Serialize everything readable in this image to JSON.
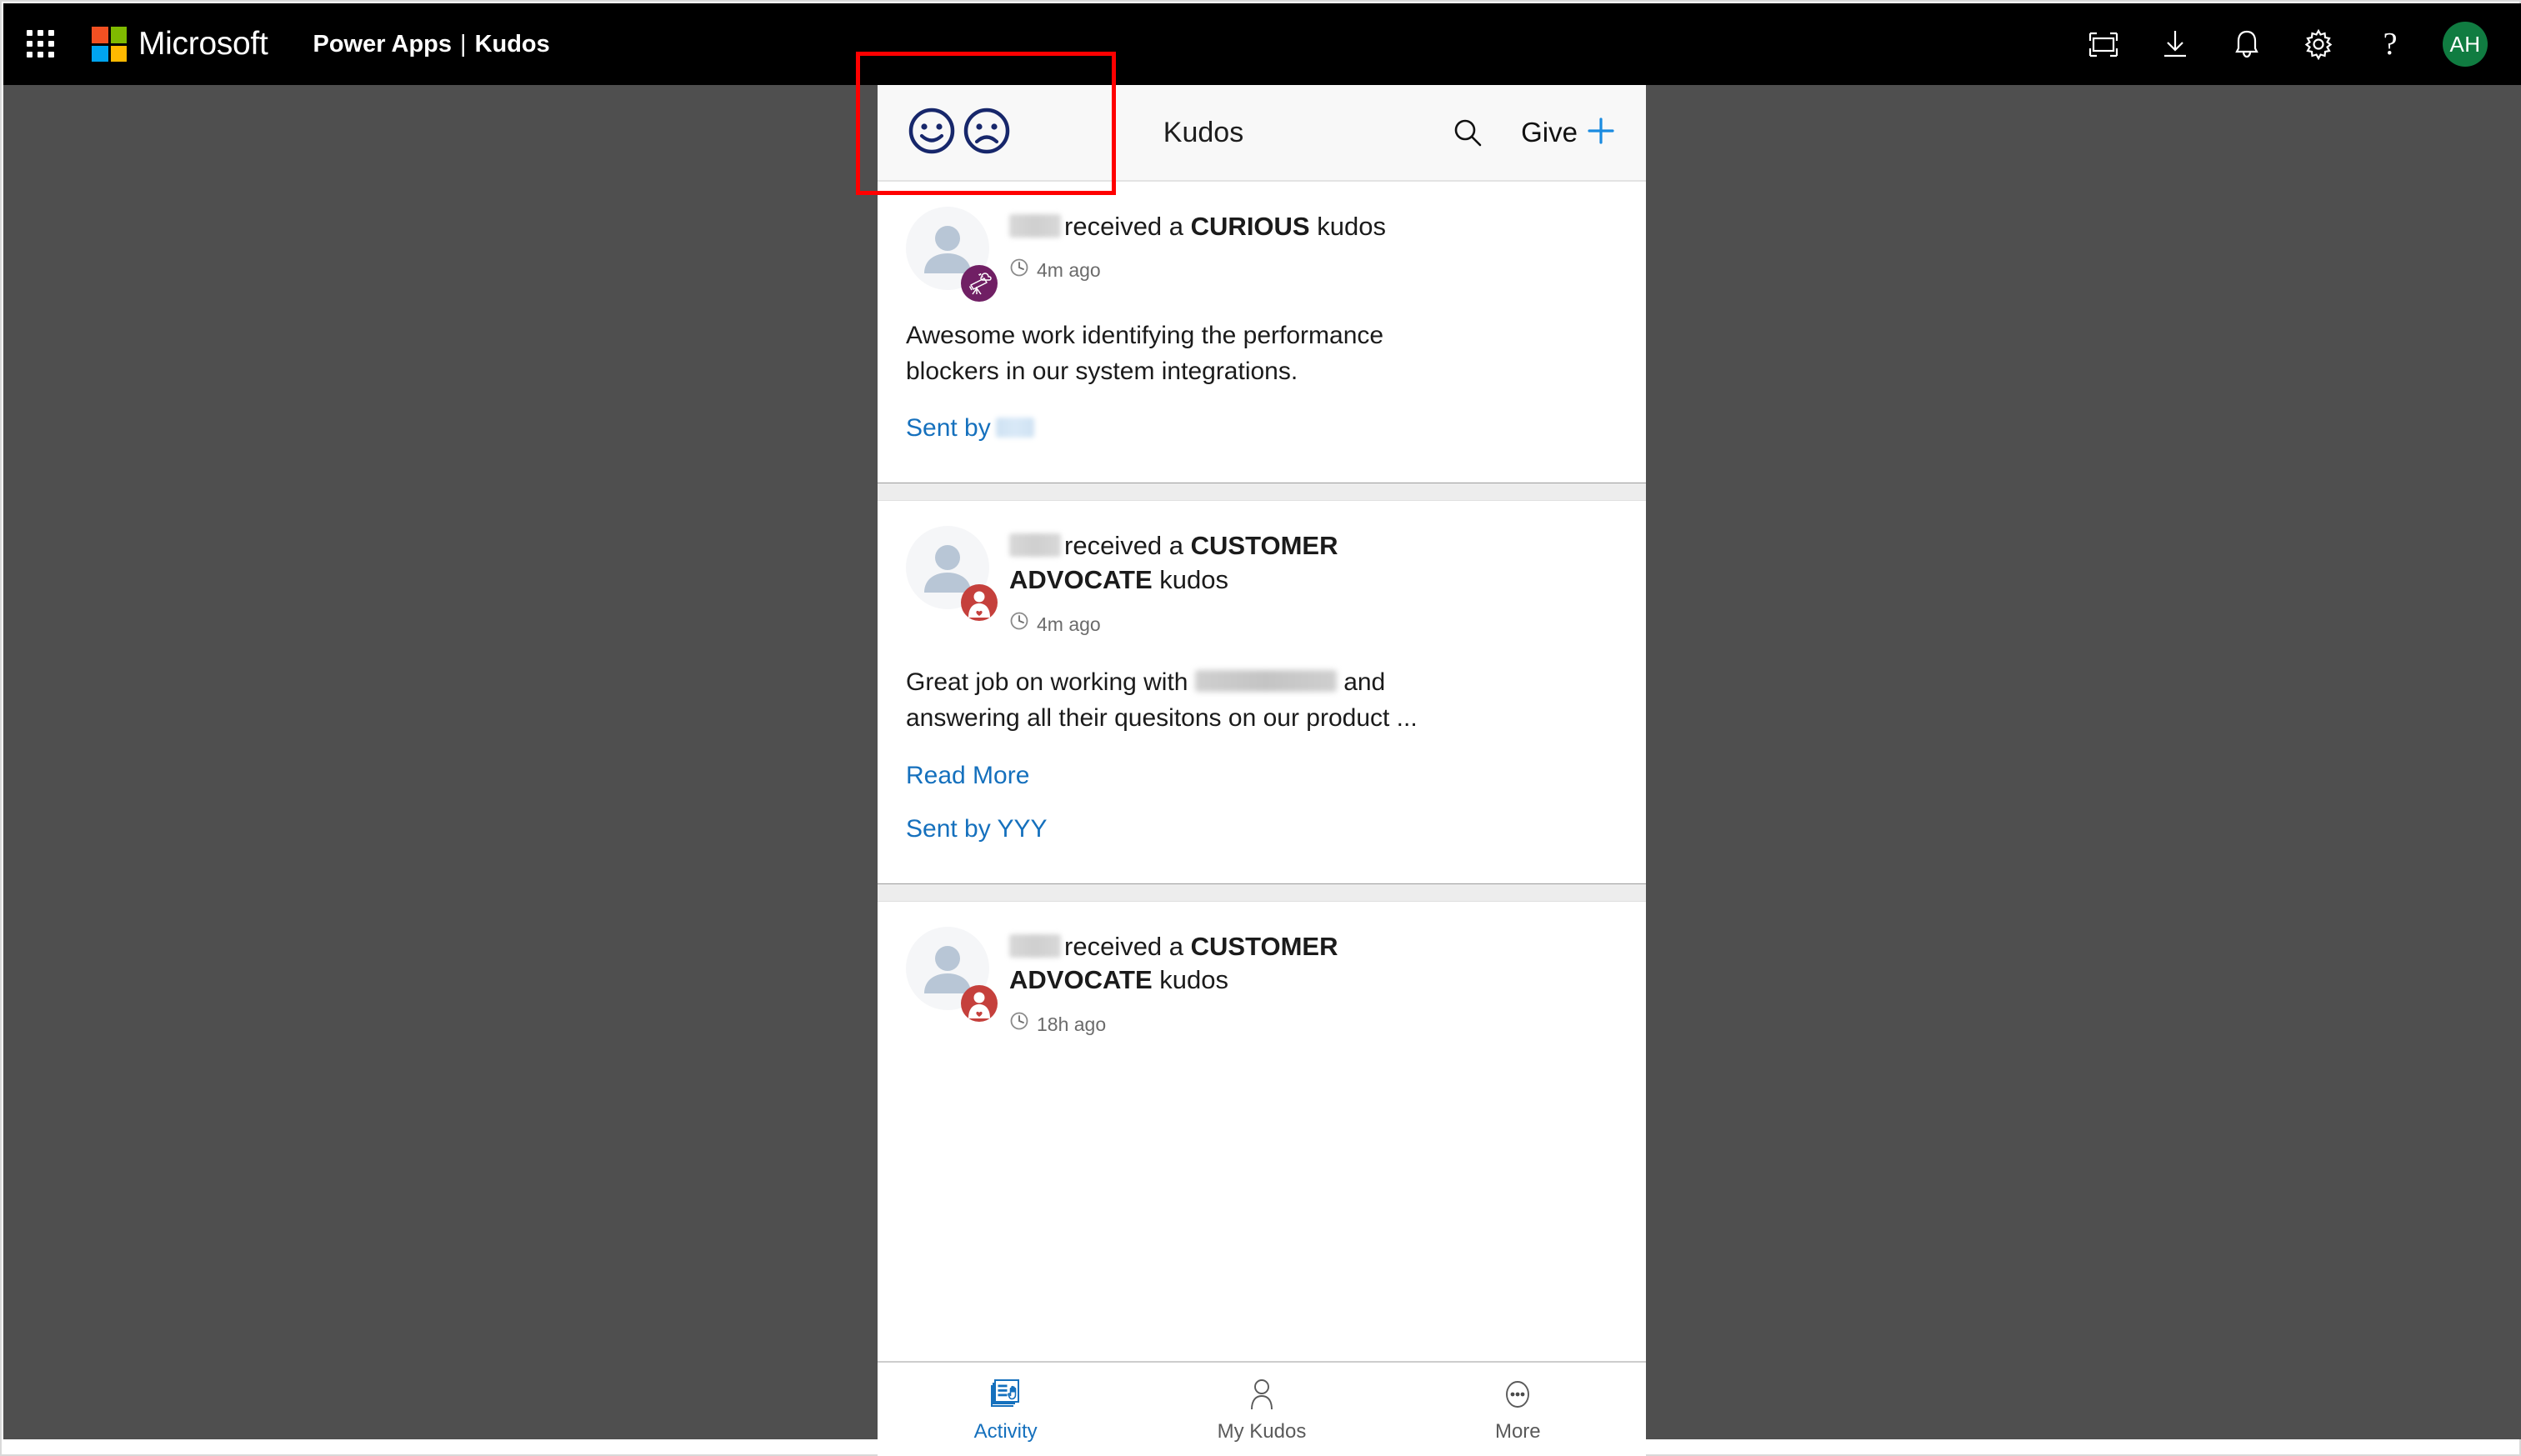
{
  "suite_bar": {
    "brand": "Microsoft",
    "app_label_primary": "Power Apps",
    "app_label_separator": "|",
    "app_label_secondary": "Kudos",
    "waffle_icon": "app-launcher-waffle-icon",
    "icons": [
      {
        "name": "fullscreen-icon",
        "title": "Fullscreen"
      },
      {
        "name": "download-icon",
        "title": "Download"
      },
      {
        "name": "notifications-bell-icon",
        "title": "Notifications"
      },
      {
        "name": "settings-gear-icon",
        "title": "Settings"
      },
      {
        "name": "help-question-icon",
        "title": "Help",
        "glyph": "?"
      }
    ],
    "avatar_initials": "AH",
    "avatar_color": "#107C41",
    "background": "#000000"
  },
  "app_header": {
    "title": "Kudos",
    "happy_face_icon": "happy-face-icon",
    "sad_face_icon": "sad-face-icon",
    "face_color": "#17276B",
    "search_icon": "search-icon",
    "give_label": "Give",
    "give_plus_icon": "plus-icon",
    "accent_color": "#1A8BE0",
    "background": "#F8F8F8"
  },
  "annotation": {
    "type": "highlight-rectangle",
    "color": "#FF0000"
  },
  "feed": {
    "cards": [
      {
        "recipient_redacted": true,
        "headline_prefix": "received a",
        "kudo_type": "CURIOUS",
        "headline_suffix": "kudos",
        "timestamp": "4m ago",
        "clock_icon": "clock-icon",
        "badge_icon": "telescope-badge-icon",
        "badge_color": "#701F64",
        "message": "Awesome work identifying the performance blockers in our system integrations.",
        "read_more_label": null,
        "sent_by_label": "Sent by",
        "sender_name": "",
        "sender_redacted": true
      },
      {
        "recipient_redacted": true,
        "headline_prefix": "received a",
        "kudo_type": "CUSTOMER ADVOCATE",
        "headline_suffix": "kudos",
        "timestamp": "4m ago",
        "clock_icon": "clock-icon",
        "badge_icon": "customer-advocate-badge-icon",
        "badge_color": "#C5403C",
        "message_part1": "Great job on working with",
        "message_redacted": true,
        "message_part2": "and answering all their quesitons on our product ...",
        "read_more_label": "Read More",
        "sent_by_label": "Sent by YYY",
        "sender_redacted": false
      },
      {
        "recipient_redacted": true,
        "headline_prefix": "received a",
        "kudo_type": "CUSTOMER ADVOCATE",
        "headline_suffix": "kudos",
        "timestamp": "18h ago",
        "clock_icon": "clock-icon",
        "badge_icon": "customer-advocate-badge-icon",
        "badge_color": "#C5403C"
      }
    ]
  },
  "bottom_nav": {
    "items": [
      {
        "label": "Activity",
        "icon": "activity-cards-hand-icon",
        "active": true
      },
      {
        "label": "My Kudos",
        "icon": "person-icon",
        "active": false
      },
      {
        "label": "More",
        "icon": "more-ellipsis-icon",
        "active": false
      }
    ],
    "active_color": "#1570BD",
    "inactive_color": "#5A5A5A"
  },
  "canvas": {
    "background": "#4F4F4F"
  }
}
